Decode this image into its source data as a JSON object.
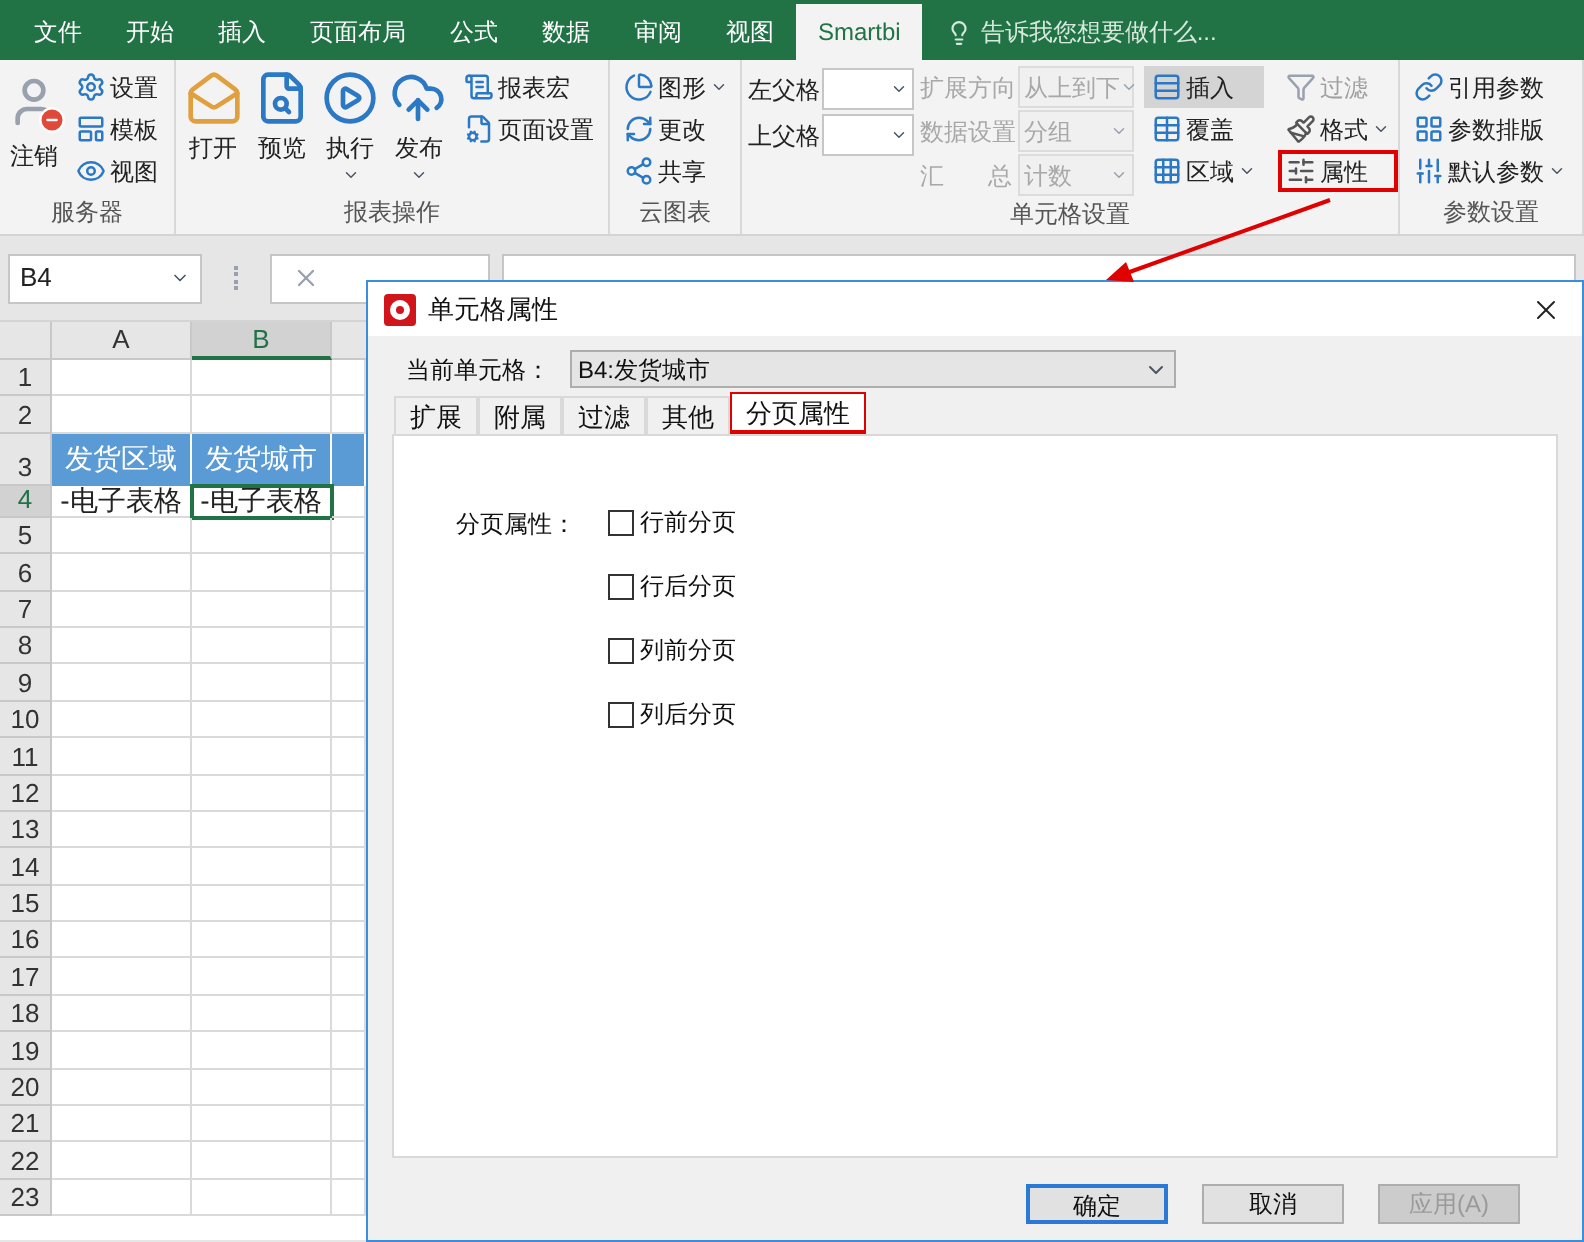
{
  "menu_tabs": [
    {
      "label": "文件",
      "selected": false
    },
    {
      "label": "开始",
      "selected": false
    },
    {
      "label": "插入",
      "selected": false
    },
    {
      "label": "页面布局",
      "selected": false
    },
    {
      "label": "公式",
      "selected": false
    },
    {
      "label": "数据",
      "selected": false
    },
    {
      "label": "审阅",
      "selected": false
    },
    {
      "label": "视图",
      "selected": false
    },
    {
      "label": "Smartbi",
      "selected": true
    }
  ],
  "tell_me": {
    "placeholder": "告诉我您想要做什么..."
  },
  "ribbon": {
    "server": {
      "label": "服务器",
      "large": {
        "label": "注销"
      },
      "small": [
        {
          "label": "设置"
        },
        {
          "label": "模板"
        },
        {
          "label": "视图"
        }
      ]
    },
    "report": {
      "label": "报表操作",
      "large": [
        {
          "label": "打开",
          "menu": false
        },
        {
          "label": "预览",
          "menu": false
        },
        {
          "label": "执行",
          "menu": true
        },
        {
          "label": "发布",
          "menu": true
        }
      ],
      "small": [
        {
          "label": "报表宏"
        },
        {
          "label": "页面设置"
        }
      ]
    },
    "cloud": {
      "label": "云图表",
      "small": [
        {
          "label": "图形",
          "menu": true
        },
        {
          "label": "更改",
          "menu": false
        },
        {
          "label": "共享",
          "menu": false
        }
      ]
    },
    "cell": {
      "label": "单元格设置",
      "parents": [
        {
          "label": "左父格"
        },
        {
          "label": "上父格"
        }
      ],
      "options": [
        {
          "label": "扩展方向",
          "value": "从上到下",
          "disabled": true
        },
        {
          "label": "数据设置",
          "value": "分组",
          "disabled": true
        },
        {
          "label": "汇 总",
          "value": "计数",
          "disabled": true
        }
      ],
      "buttons": [
        {
          "label": "插入",
          "selected": true,
          "menu": false
        },
        {
          "label": "覆盖",
          "selected": false,
          "menu": false
        },
        {
          "label": "区域",
          "selected": false,
          "menu": true
        }
      ],
      "tools": [
        {
          "label": "过滤",
          "disabled": true,
          "menu": false,
          "highlighted": false
        },
        {
          "label": "格式",
          "disabled": false,
          "menu": true,
          "highlighted": false
        },
        {
          "label": "属性",
          "disabled": false,
          "menu": false,
          "highlighted": true
        }
      ]
    },
    "params": {
      "label": "参数设置",
      "small": [
        {
          "label": "引用参数",
          "menu": false
        },
        {
          "label": "参数排版",
          "menu": false
        },
        {
          "label": "默认参数",
          "menu": true
        }
      ]
    }
  },
  "formula_bar": {
    "name_box": "B4"
  },
  "sheet": {
    "columns": [
      {
        "label": "A",
        "selected": false
      },
      {
        "label": "B",
        "selected": true
      }
    ],
    "rows": [
      {
        "label": "1",
        "cells": []
      },
      {
        "label": "2",
        "cells": []
      },
      {
        "label": "3",
        "cells": [
          {
            "text": "发货区域",
            "header": true
          },
          {
            "text": "发货城市",
            "header": true
          },
          {
            "header": true
          }
        ]
      },
      {
        "label": "4",
        "cells": [
          {
            "text": "-电子表格",
            "header": false
          },
          {
            "text": "-电子表格",
            "header": false,
            "selected": true
          }
        ]
      },
      {
        "label": "5",
        "cells": []
      },
      {
        "label": "6",
        "cells": []
      },
      {
        "label": "7",
        "cells": []
      },
      {
        "label": "8",
        "cells": []
      },
      {
        "label": "9",
        "cells": []
      },
      {
        "label": "10",
        "cells": []
      },
      {
        "label": "11",
        "cells": []
      },
      {
        "label": "12",
        "cells": []
      },
      {
        "label": "13",
        "cells": []
      },
      {
        "label": "14",
        "cells": []
      },
      {
        "label": "15",
        "cells": []
      },
      {
        "label": "16",
        "cells": []
      },
      {
        "label": "17",
        "cells": []
      },
      {
        "label": "18",
        "cells": []
      },
      {
        "label": "19",
        "cells": []
      },
      {
        "label": "20",
        "cells": []
      },
      {
        "label": "21",
        "cells": []
      },
      {
        "label": "22",
        "cells": []
      },
      {
        "label": "23",
        "cells": []
      }
    ]
  },
  "dialog": {
    "title": "单元格属性",
    "current_cell_label": "当前单元格：",
    "current_cell": "B4:发货城市",
    "tabs": [
      {
        "label": "扩展",
        "selected": false,
        "highlighted": false
      },
      {
        "label": "附属",
        "selected": false,
        "highlighted": false
      },
      {
        "label": "过滤",
        "selected": false,
        "highlighted": false
      },
      {
        "label": "其他",
        "selected": false,
        "highlighted": false
      },
      {
        "label": "分页属性",
        "selected": true,
        "highlighted": true
      }
    ],
    "group_label": "分页属性：",
    "options": [
      {
        "label": "行前分页",
        "checked": false
      },
      {
        "label": "行后分页",
        "checked": false
      },
      {
        "label": "列前分页",
        "checked": false
      },
      {
        "label": "列后分页",
        "checked": false
      }
    ],
    "buttons": [
      {
        "label": "确定",
        "kind": "default",
        "disabled": false
      },
      {
        "label": "取消",
        "kind": "normal",
        "disabled": false
      },
      {
        "label": "应用(A)",
        "kind": "normal",
        "disabled": true
      }
    ]
  }
}
